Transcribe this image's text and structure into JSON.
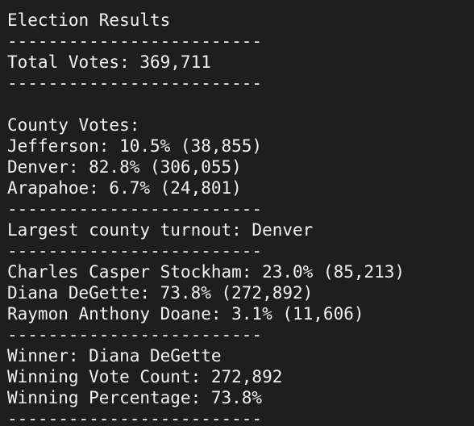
{
  "lines": [
    "Election Results",
    "-------------------------",
    "Total Votes: 369,711",
    "-------------------------",
    "",
    "County Votes:",
    "Jefferson: 10.5% (38,855)",
    "Denver: 82.8% (306,055)",
    "Arapahoe: 6.7% (24,801)",
    "-------------------------",
    "Largest county turnout: Denver",
    "-------------------------",
    "Charles Casper Stockham: 23.0% (85,213)",
    "Diana DeGette: 73.8% (272,892)",
    "Raymon Anthony Doane: 3.1% (11,606)",
    "-------------------------",
    "Winner: Diana DeGette",
    "Winning Vote Count: 272,892",
    "Winning Percentage: 73.8%",
    "-------------------------"
  ],
  "colors": {
    "background": "#1e1e1e",
    "text": "#f2f2f2"
  }
}
